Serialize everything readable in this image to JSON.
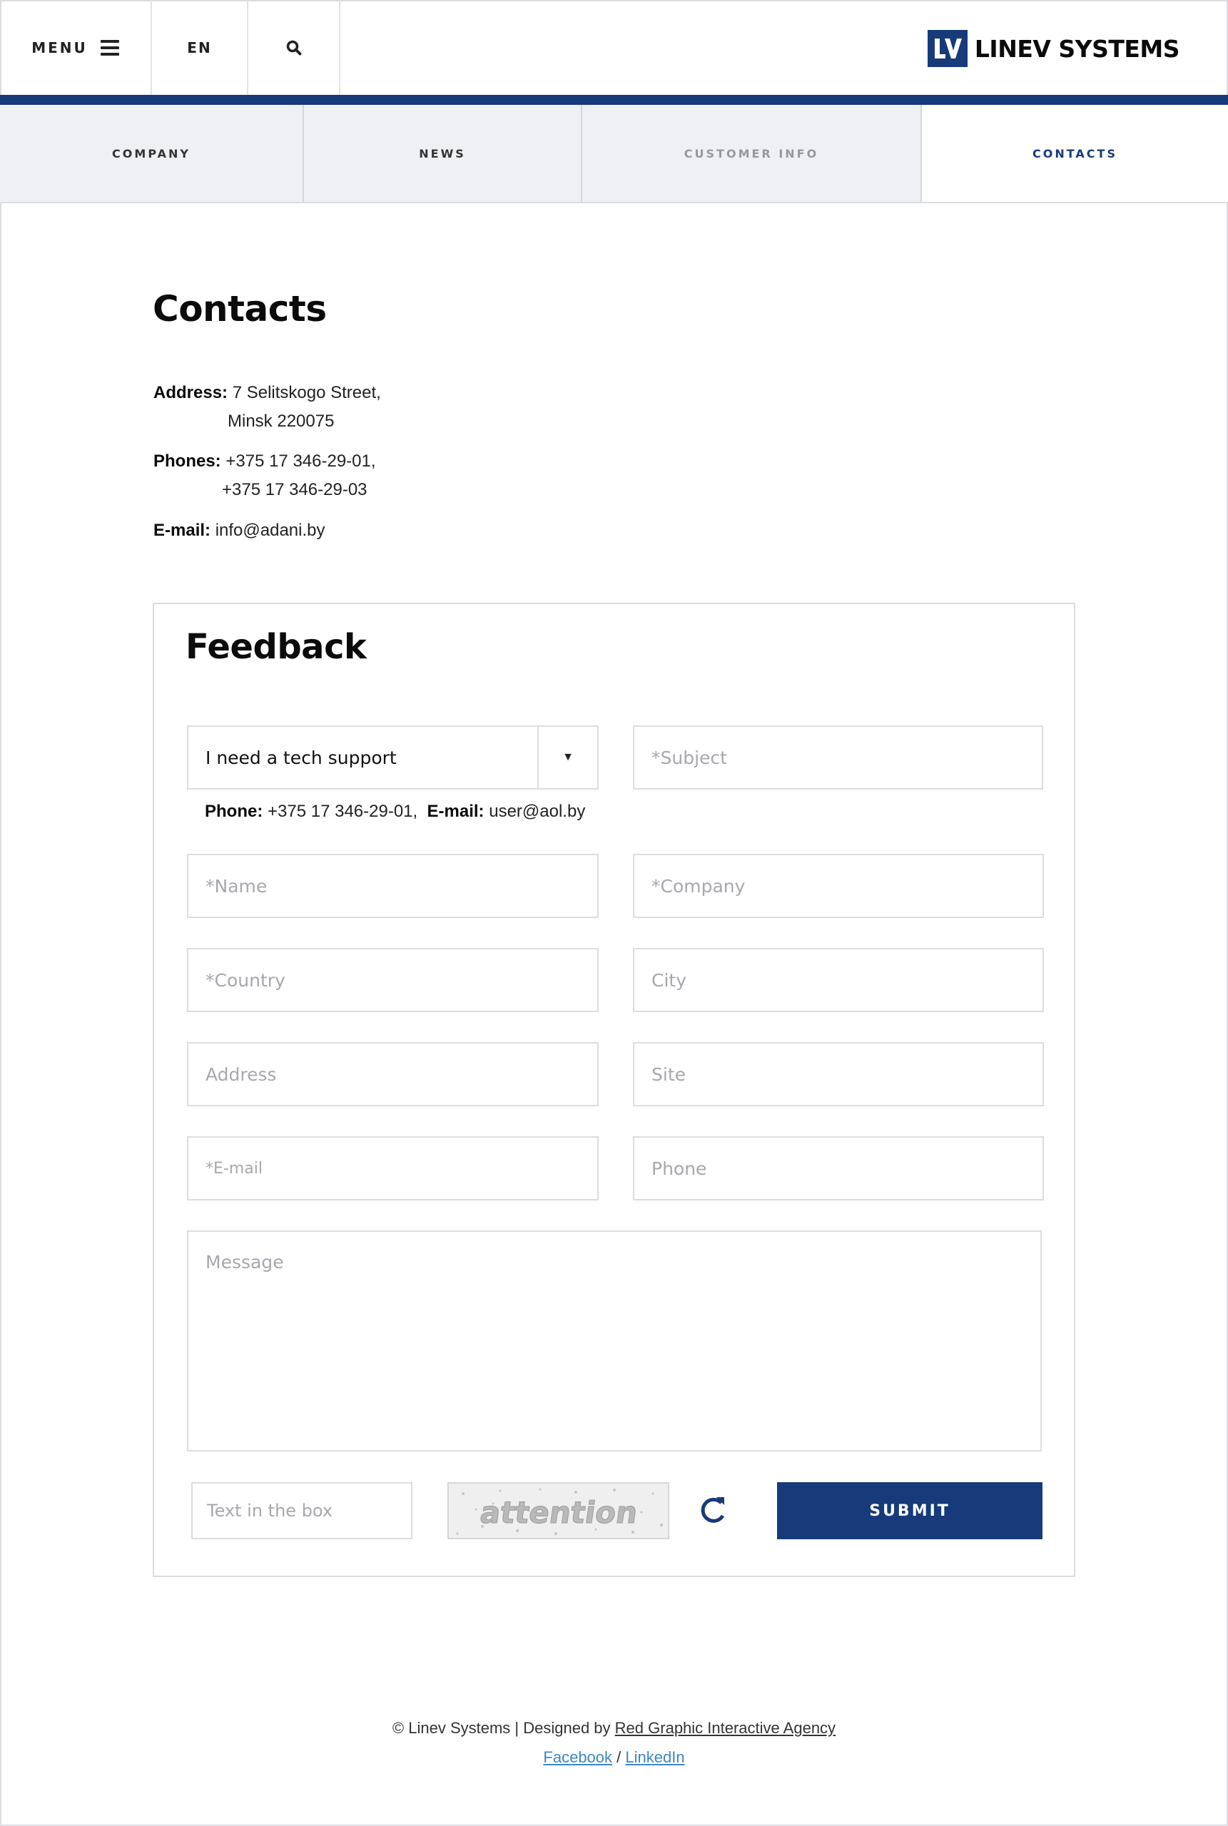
{
  "header": {
    "menu_label": "MENU",
    "lang_label": "EN",
    "logo_mark": "LV",
    "logo_text": "LINEV SYSTEMS",
    "accent_color": "#163a7a"
  },
  "nav": {
    "tabs": [
      {
        "label": "COMPANY",
        "state": "normal"
      },
      {
        "label": "NEWS",
        "state": "normal"
      },
      {
        "label": "CUSTOMER INFO",
        "state": "muted"
      },
      {
        "label": "CONTACTS",
        "state": "active"
      }
    ]
  },
  "contacts": {
    "title": "Contacts",
    "address_label": "Address:",
    "address_line1": "7 Selitskogo Street,",
    "address_line2": "Minsk 220075",
    "phones_label": "Phones:",
    "phone1": "+375 17 346-29-01,",
    "phone2": "+375 17 346-29-03",
    "email_label": "E-mail:",
    "email": "info@adani.by"
  },
  "feedback": {
    "title": "Feedback",
    "topic_select": {
      "value": "I need a tech support"
    },
    "subject_placeholder": "*Subject",
    "contact_phone_label": "Phone:",
    "contact_phone": "+375 17 346-29-01,",
    "contact_email_label": "E-mail:",
    "contact_email": "user@aol.by",
    "name_placeholder": "*Name",
    "company_placeholder": "*Company",
    "country_placeholder": "*Country",
    "city_placeholder": "City",
    "address_placeholder": "Address",
    "site_placeholder": "Site",
    "email_placeholder": "*E-mail",
    "phone_placeholder": "Phone",
    "message_placeholder": "Message",
    "captcha_placeholder": "Text in the box",
    "captcha_text": "attention",
    "submit_label": "SUBMIT"
  },
  "footer": {
    "copyright": "© Linev Systems | Designed by",
    "agency_link": "Red Graphic Interactive Agency",
    "facebook": "Facebook",
    "separator": "/",
    "linkedin": "LinkedIn"
  }
}
